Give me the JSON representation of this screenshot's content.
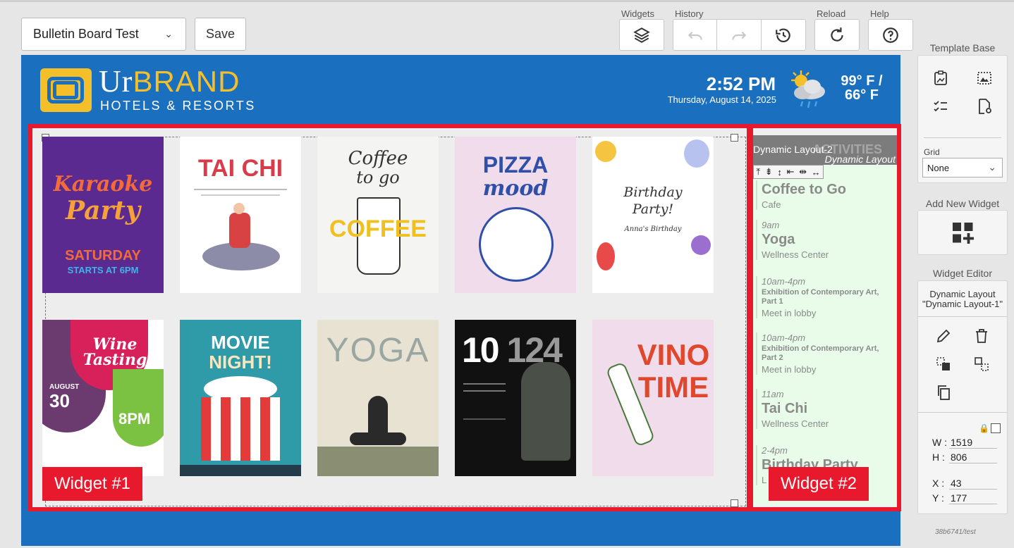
{
  "toolbar": {
    "template_name": "Bulletin Board Test",
    "save_label": "Save",
    "widgets_label": "Widgets",
    "history_label": "History",
    "reload_label": "Reload",
    "help_label": "Help"
  },
  "header": {
    "brand_ur": "Ur",
    "brand_name": "BRAND",
    "brand_sub": "HOTELS & RESORTS",
    "time": "2:52 PM",
    "date": "Thursday, August 14, 2025",
    "temp_high": "99° F /",
    "temp_low": "66° F",
    "weather_icon": "partly-cloudy-rain-icon"
  },
  "widget1": {
    "label": "Widget #1",
    "posters": [
      {
        "name": "karaoke-party-poster",
        "lines": [
          "Karaoke",
          "Party",
          "SATURDAY",
          "STARTS AT 6PM"
        ]
      },
      {
        "name": "tai-chi-poster",
        "lines": [
          "TAI CHI"
        ]
      },
      {
        "name": "coffee-to-go-poster",
        "lines": [
          "Coffee",
          "to go",
          "COFFEE"
        ]
      },
      {
        "name": "pizza-mood-poster",
        "lines": [
          "PIZZA",
          "mood"
        ]
      },
      {
        "name": "birthday-party-poster",
        "lines": [
          "Birthday",
          "Party!",
          "Anna's Birthday"
        ]
      },
      {
        "name": "wine-tasting-poster",
        "lines": [
          "Wine",
          "Tasting",
          "AUGUST",
          "30",
          "8PM"
        ]
      },
      {
        "name": "movie-night-poster",
        "lines": [
          "MOVIE",
          "NIGHT!"
        ]
      },
      {
        "name": "yoga-poster",
        "lines": [
          "YOGA"
        ]
      },
      {
        "name": "exhibition-poster",
        "lines": [
          "10",
          "124"
        ]
      },
      {
        "name": "vino-time-poster",
        "lines": [
          "VINO",
          "TIME"
        ]
      }
    ]
  },
  "widget2": {
    "label": "Widget #2",
    "title": "Dynamic Layout-2",
    "ghost_title": "ACTIVITIES",
    "subtitle": "Dynamic Layout",
    "tools": [
      "⤒",
      "⇟",
      "↕",
      "⇤",
      "⇹",
      "↔"
    ],
    "events": [
      {
        "time": "",
        "name": "Coffee to Go",
        "location": "Cafe",
        "small": false
      },
      {
        "time": "9am",
        "name": "Yoga",
        "location": "Wellness Center",
        "small": false
      },
      {
        "time": "10am-4pm",
        "name": "Exhibition of Contemporary Art, Part 1",
        "location": "Meet in lobby",
        "small": true
      },
      {
        "time": "10am-4pm",
        "name": "Exhibition of Contemporary Art, Part 2",
        "location": "Meet in lobby",
        "small": true
      },
      {
        "time": "11am",
        "name": "Tai Chi",
        "location": "Wellness Center",
        "small": false
      },
      {
        "time": "2-4pm",
        "name": "Birthday Party",
        "location": "L",
        "small": false
      }
    ]
  },
  "panel": {
    "template_base_label": "Template Base",
    "grid_label": "Grid",
    "grid_value": "None",
    "add_widget_label": "Add New Widget",
    "widget_editor_label": "Widget Editor",
    "editor_type": "Dynamic Layout",
    "editor_name": "\"Dynamic Layout-1\"",
    "w_label": "W :",
    "w_value": "1519",
    "h_label": "H :",
    "h_value": "806",
    "x_label": "X :",
    "x_value": "43",
    "y_label": "Y :",
    "y_value": "177"
  },
  "footer_id": "38b6741/test",
  "colors": {
    "brand_blue": "#1b6fbf",
    "brand_yellow": "#f5bf2a",
    "highlight_red": "#e8192c",
    "list_bg": "#e8fce9"
  }
}
